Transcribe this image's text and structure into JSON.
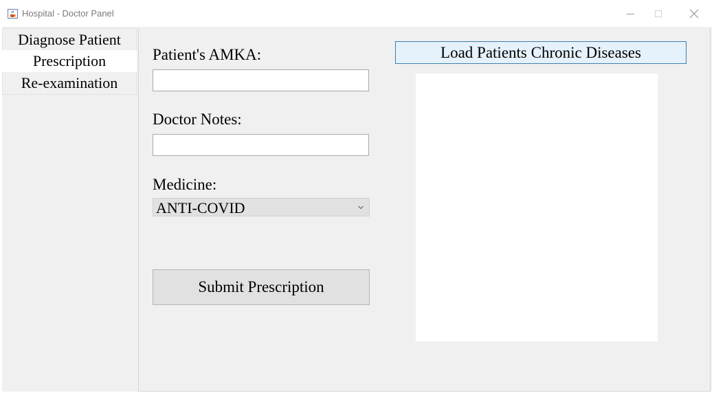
{
  "window": {
    "title": "Hospital - Doctor Panel",
    "icons": {
      "app": "java-cup-icon",
      "minimize": "minimize-icon",
      "maximize": "maximize-icon",
      "close": "close-icon"
    }
  },
  "tabs": [
    {
      "label": "Diagnose Patient"
    },
    {
      "label": "Prescription",
      "selected": true
    },
    {
      "label": "Re-examination"
    }
  ],
  "form": {
    "amka_label": "Patient's AMKA:",
    "amka_value": "",
    "notes_label": "Doctor Notes:",
    "notes_value": "",
    "medicine_label": "Medicine:",
    "medicine_selected": "ANTI-COVID",
    "submit_label": "Submit Prescription"
  },
  "chronic": {
    "load_label": "Load Patients Chronic Diseases",
    "items": []
  },
  "colors": {
    "panel_bg": "#f0f0f0",
    "button_bg": "#e1e1e1",
    "focused_button_border": "#3c7fb1",
    "focused_button_bg": "#e5f1fb"
  }
}
